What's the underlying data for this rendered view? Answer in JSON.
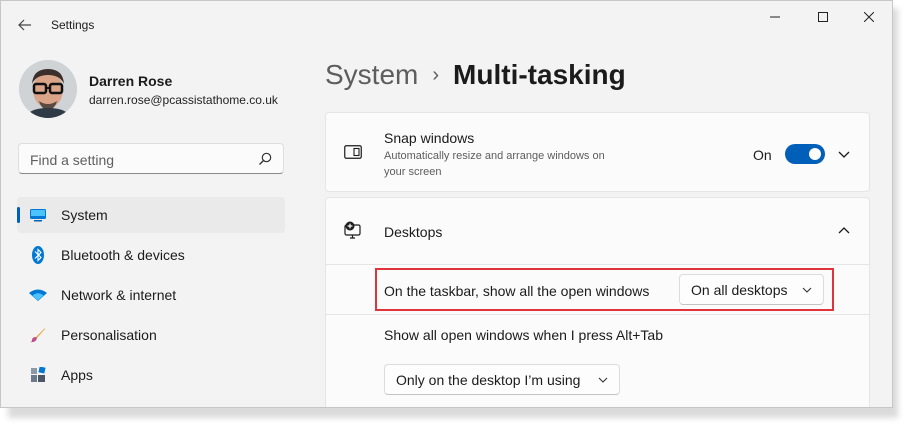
{
  "window": {
    "title": "Settings"
  },
  "profile": {
    "name": "Darren Rose",
    "email": "darren.rose@pcassistathome.co.uk"
  },
  "search": {
    "placeholder": "Find a setting"
  },
  "nav": [
    {
      "label": "System",
      "icon": "monitor-icon",
      "active": true
    },
    {
      "label": "Bluetooth & devices",
      "icon": "bluetooth-icon"
    },
    {
      "label": "Network & internet",
      "icon": "wifi-icon"
    },
    {
      "label": "Personalisation",
      "icon": "paintbrush-icon"
    },
    {
      "label": "Apps",
      "icon": "apps-icon"
    }
  ],
  "header": {
    "parent": "System",
    "separator": "›",
    "current": "Multi-tasking"
  },
  "snap": {
    "title": "Snap windows",
    "description_line1": "Automatically resize and arrange windows on",
    "description_line2": "your screen",
    "state_label": "On",
    "enabled": true
  },
  "desktops": {
    "title": "Desktops",
    "taskbar_label": "On the taskbar, show all the open windows",
    "taskbar_value": "On all desktops",
    "alttab_label": "Show all open windows when I press Alt+Tab",
    "alttab_value": "Only on the desktop I’m using"
  },
  "colors": {
    "accent": "#005fb8",
    "highlight": "#e0343c"
  }
}
